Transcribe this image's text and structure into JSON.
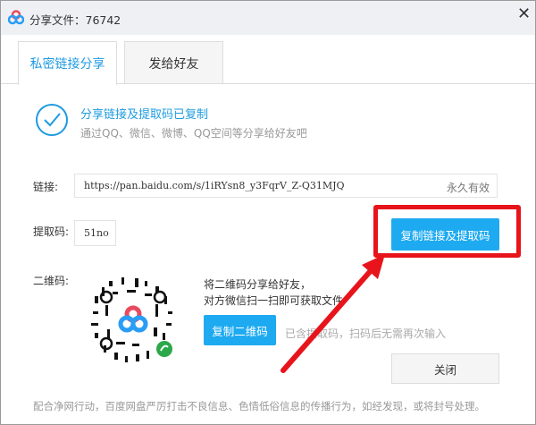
{
  "window": {
    "title": "分享文件：76742",
    "close_icon": "close-icon"
  },
  "tabs": [
    {
      "label": "私密链接分享",
      "active": true
    },
    {
      "label": "发给好友",
      "active": false
    }
  ],
  "status": {
    "heading": "分享链接及提取码已复制",
    "subtext": "通过QQ、微信、微博、QQ空间等分享给好友吧"
  },
  "link": {
    "label": "链接:",
    "value": "https://pan.baidu.com/s/1iRYsn8_y3FqrV_Z-Q31MJQ",
    "validity": "永久有效"
  },
  "code": {
    "label": "提取码:",
    "value": "51no"
  },
  "copy_link_button": "复制链接及提取码",
  "qr": {
    "label": "二维码:",
    "line1": "将二维码分享给好友，",
    "line2": "对方微信扫一扫即可获取文件",
    "copy_button": "复制二维码",
    "hint": "已含提取码，扫码后无需再次输入"
  },
  "close_button": "关闭",
  "footer": "配合净网行动，百度网盘严厉打击不良信息、色情低俗信息的传播行为，如经发现，或将封号处理。",
  "colors": {
    "accent": "#1eaaf1",
    "highlight": "#e8141b"
  }
}
